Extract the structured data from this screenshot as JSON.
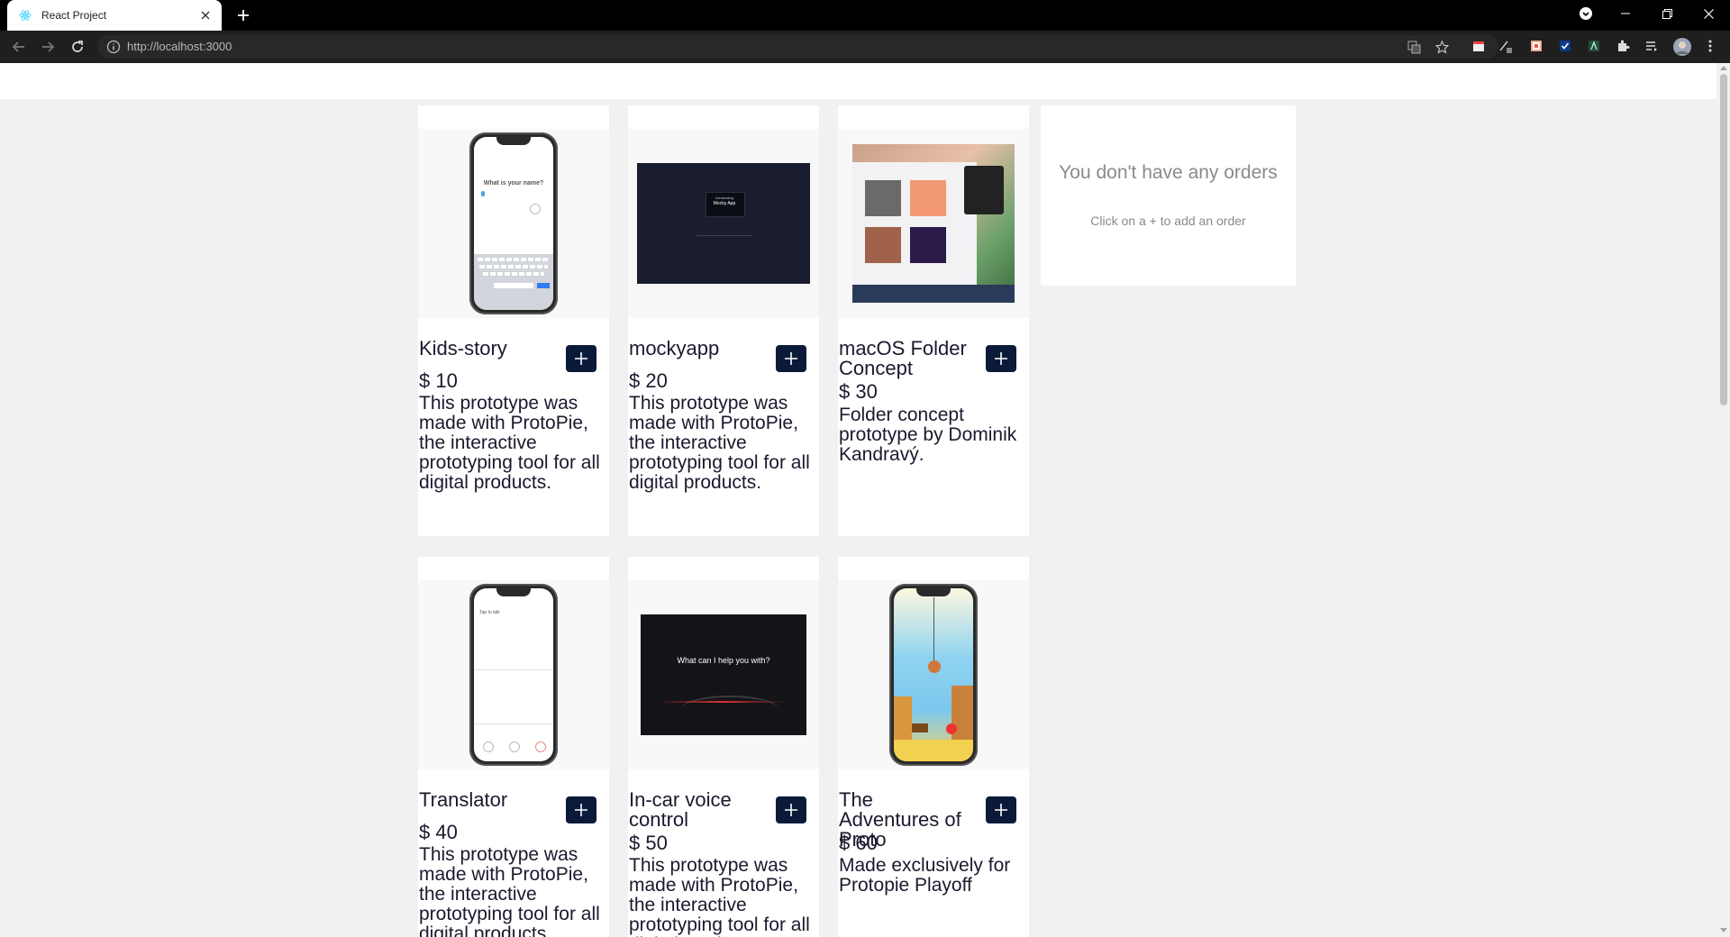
{
  "browser": {
    "tab_title": "React Project",
    "url": "http://localhost:3000"
  },
  "products": [
    {
      "title": "Kids-story",
      "price": "$ 10",
      "description": "This prototype was made with ProtoPie, the interactive prototyping tool for all digital products.",
      "image_text": "What is your name?"
    },
    {
      "title": "mockyapp",
      "price": "$ 20",
      "description": "This prototype was made with ProtoPie, the interactive prototyping tool for all digital products.",
      "image_text_line1": "Introducing",
      "image_text_line2": "Mocky App"
    },
    {
      "title": "macOS Folder Concept",
      "price": "$ 30",
      "description": "Folder concept prototype by Dominik Kandravý."
    },
    {
      "title": "Translator",
      "price": "$ 40",
      "description": "This prototype was made with ProtoPie, the interactive prototyping tool for all digital products.",
      "image_text": "Tap to talk"
    },
    {
      "title": "In-car voice control",
      "price": "$ 50",
      "description": "This prototype was made with ProtoPie, the interactive prototyping tool for all digital products.",
      "image_text": "What can I help you with?"
    },
    {
      "title": "The Adventures of Proto",
      "price": "$ 60",
      "description": "Made exclusively for Protopie Playoff"
    }
  ],
  "orders": {
    "empty_title": "You don't have any orders",
    "empty_hint": "Click on a + to add an order"
  },
  "add_button_glyph": "+",
  "colors": {
    "add_button": "#0c1a3a",
    "text": "#1a1a2e",
    "muted": "#8a8a8a"
  }
}
